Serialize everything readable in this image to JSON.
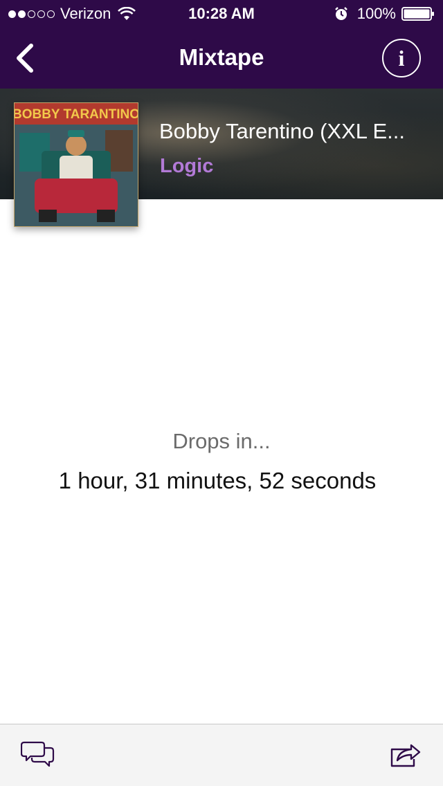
{
  "status_bar": {
    "carrier": "Verizon",
    "time": "10:28 AM",
    "battery": "100%",
    "signal_strength": 2,
    "signal_max": 5
  },
  "nav": {
    "title": "Mixtape",
    "back_icon": "chevron-left-icon",
    "info_label": "i"
  },
  "track": {
    "title": "Bobby Tarentino (XXL E...",
    "artist": "Logic",
    "album_art_text": "BOBBY TARANTINO",
    "artist_color": "#b27ad6"
  },
  "countdown": {
    "label": "Drops in...",
    "value": "1 hour, 31 minutes, 52 seconds"
  },
  "toolbar": {
    "left_icon": "chat-bubbles-icon",
    "right_icon": "share-icon"
  },
  "colors": {
    "nav_background": "#2e0a48",
    "toolbar_icon": "#2e0a48"
  }
}
